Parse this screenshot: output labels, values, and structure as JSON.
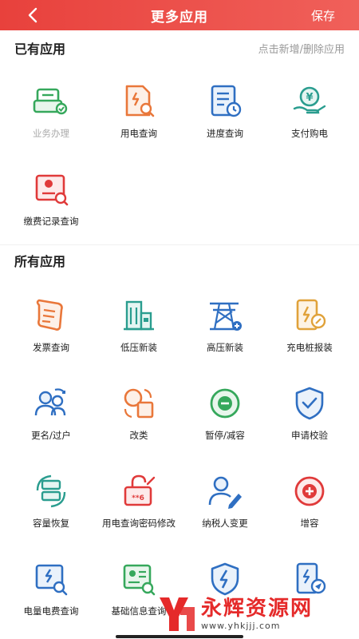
{
  "header": {
    "title": "更多应用",
    "save_label": "保存"
  },
  "owned": {
    "title": "已有应用",
    "hint": "点击新增/删除应用",
    "items": [
      {
        "label": "业务办理",
        "icon": "business-icon",
        "dim": true
      },
      {
        "label": "用电查询",
        "icon": "usage-query-icon"
      },
      {
        "label": "进度查询",
        "icon": "progress-query-icon"
      },
      {
        "label": "支付购电",
        "icon": "payment-icon"
      },
      {
        "label": "缴费记录查询",
        "icon": "payment-record-icon"
      }
    ]
  },
  "all": {
    "title": "所有应用",
    "items": [
      {
        "label": "发票查询",
        "icon": "invoice-icon"
      },
      {
        "label": "低压新装",
        "icon": "low-voltage-icon"
      },
      {
        "label": "高压新装",
        "icon": "high-voltage-icon"
      },
      {
        "label": "充电桩报装",
        "icon": "charging-pile-icon"
      },
      {
        "label": "更名/过户",
        "icon": "rename-transfer-icon"
      },
      {
        "label": "改类",
        "icon": "change-category-icon"
      },
      {
        "label": "暂停/减容",
        "icon": "pause-icon"
      },
      {
        "label": "申请校验",
        "icon": "verify-shield-icon"
      },
      {
        "label": "容量恢复",
        "icon": "capacity-restore-icon"
      },
      {
        "label": "用电查询密码修改",
        "icon": "password-lock-icon"
      },
      {
        "label": "纳税人变更",
        "icon": "taxpayer-icon"
      },
      {
        "label": "增容",
        "icon": "add-capacity-icon"
      },
      {
        "label": "电量电费查询",
        "icon": "bill-query-icon"
      },
      {
        "label": "基础信息查询",
        "icon": "info-card-icon"
      },
      {
        "label": "",
        "icon": "lightning-shield-icon"
      },
      {
        "label": "",
        "icon": "document-send-icon"
      }
    ]
  },
  "watermark": {
    "big": "永辉资源网",
    "small": "www.yhkjjj.com"
  },
  "colors": {
    "header_red": "#e8413c",
    "green": "#36a85c",
    "orange": "#e9773a",
    "blue": "#2f6fc2",
    "teal": "#2a9d8f",
    "red": "#e03a3a"
  }
}
